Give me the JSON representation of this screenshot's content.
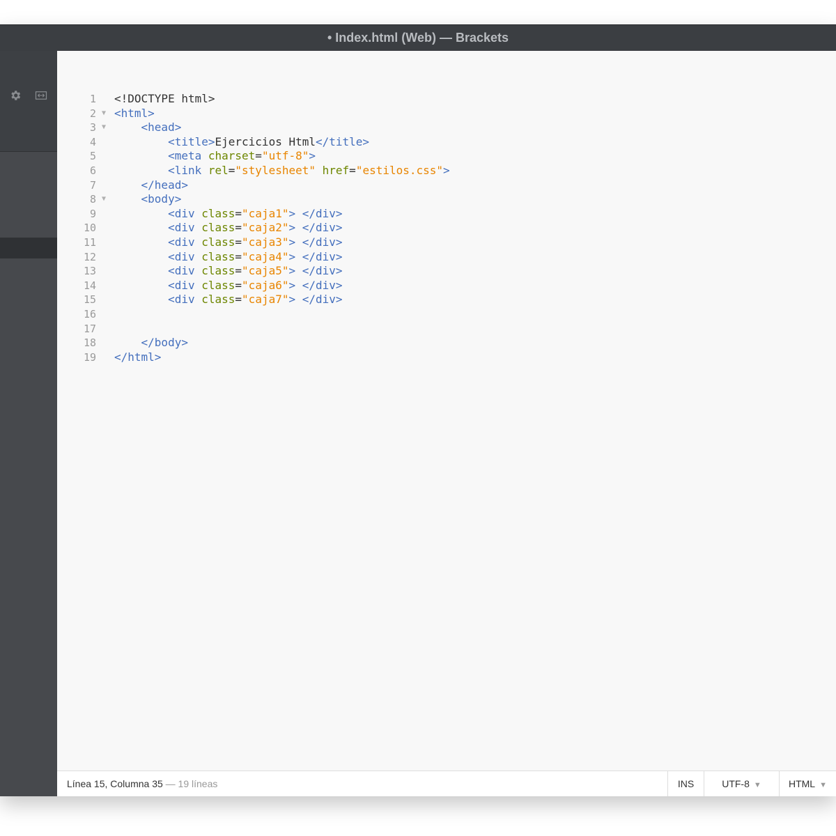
{
  "window": {
    "title": "• Index.html (Web) — Brackets"
  },
  "sidebar": {
    "icons": [
      "gear-icon",
      "split-view-icon"
    ]
  },
  "editor": {
    "lines": [
      {
        "n": "1",
        "fold": false
      },
      {
        "n": "2",
        "fold": true
      },
      {
        "n": "3",
        "fold": true
      },
      {
        "n": "4",
        "fold": false
      },
      {
        "n": "5",
        "fold": false
      },
      {
        "n": "6",
        "fold": false
      },
      {
        "n": "7",
        "fold": false
      },
      {
        "n": "8",
        "fold": true
      },
      {
        "n": "9",
        "fold": false
      },
      {
        "n": "10",
        "fold": false
      },
      {
        "n": "11",
        "fold": false
      },
      {
        "n": "12",
        "fold": false
      },
      {
        "n": "13",
        "fold": false
      },
      {
        "n": "14",
        "fold": false
      },
      {
        "n": "15",
        "fold": false
      },
      {
        "n": "16",
        "fold": false
      },
      {
        "n": "17",
        "fold": false
      },
      {
        "n": "18",
        "fold": false
      },
      {
        "n": "19",
        "fold": false
      }
    ],
    "code": [
      [
        [
          "p",
          "<!DOCTYPE html>"
        ]
      ],
      [
        [
          "t",
          "<html>"
        ]
      ],
      [
        [
          "p",
          "    "
        ],
        [
          "t",
          "<head>"
        ]
      ],
      [
        [
          "p",
          "        "
        ],
        [
          "t",
          "<title>"
        ],
        [
          "p",
          "Ejercicios Html"
        ],
        [
          "t",
          "</title>"
        ]
      ],
      [
        [
          "p",
          "        "
        ],
        [
          "t",
          "<meta "
        ],
        [
          "a",
          "charset"
        ],
        [
          "p",
          "="
        ],
        [
          "v",
          "\"utf-8\""
        ],
        [
          "t",
          ">"
        ]
      ],
      [
        [
          "p",
          "        "
        ],
        [
          "t",
          "<link "
        ],
        [
          "a",
          "rel"
        ],
        [
          "p",
          "="
        ],
        [
          "v",
          "\"stylesheet\""
        ],
        [
          "p",
          " "
        ],
        [
          "a",
          "href"
        ],
        [
          "p",
          "="
        ],
        [
          "v",
          "\"estilos.css\""
        ],
        [
          "t",
          ">"
        ]
      ],
      [
        [
          "p",
          "    "
        ],
        [
          "t",
          "</head>"
        ]
      ],
      [
        [
          "p",
          "    "
        ],
        [
          "t",
          "<body>"
        ]
      ],
      [
        [
          "p",
          "        "
        ],
        [
          "t",
          "<div "
        ],
        [
          "a",
          "class"
        ],
        [
          "p",
          "="
        ],
        [
          "v",
          "\"caja1\""
        ],
        [
          "t",
          ">"
        ],
        [
          "p",
          " "
        ],
        [
          "t",
          "</div>"
        ]
      ],
      [
        [
          "p",
          "        "
        ],
        [
          "t",
          "<div "
        ],
        [
          "a",
          "class"
        ],
        [
          "p",
          "="
        ],
        [
          "v",
          "\"caja2\""
        ],
        [
          "t",
          ">"
        ],
        [
          "p",
          " "
        ],
        [
          "t",
          "</div>"
        ]
      ],
      [
        [
          "p",
          "        "
        ],
        [
          "t",
          "<div "
        ],
        [
          "a",
          "class"
        ],
        [
          "p",
          "="
        ],
        [
          "v",
          "\"caja3\""
        ],
        [
          "t",
          ">"
        ],
        [
          "p",
          " "
        ],
        [
          "t",
          "</div>"
        ]
      ],
      [
        [
          "p",
          "        "
        ],
        [
          "t",
          "<div "
        ],
        [
          "a",
          "class"
        ],
        [
          "p",
          "="
        ],
        [
          "v",
          "\"caja4\""
        ],
        [
          "t",
          ">"
        ],
        [
          "p",
          " "
        ],
        [
          "t",
          "</div>"
        ]
      ],
      [
        [
          "p",
          "        "
        ],
        [
          "t",
          "<div "
        ],
        [
          "a",
          "class"
        ],
        [
          "p",
          "="
        ],
        [
          "v",
          "\"caja5\""
        ],
        [
          "t",
          ">"
        ],
        [
          "p",
          " "
        ],
        [
          "t",
          "</div>"
        ]
      ],
      [
        [
          "p",
          "        "
        ],
        [
          "t",
          "<div "
        ],
        [
          "a",
          "class"
        ],
        [
          "p",
          "="
        ],
        [
          "v",
          "\"caja6\""
        ],
        [
          "t",
          ">"
        ],
        [
          "p",
          " "
        ],
        [
          "t",
          "</div>"
        ]
      ],
      [
        [
          "p",
          "        "
        ],
        [
          "t",
          "<div "
        ],
        [
          "a",
          "class"
        ],
        [
          "p",
          "="
        ],
        [
          "v",
          "\"caja7\""
        ],
        [
          "t",
          ">"
        ],
        [
          "p",
          " "
        ],
        [
          "t",
          "</div>"
        ]
      ],
      [],
      [],
      [
        [
          "p",
          "    "
        ],
        [
          "t",
          "</body>"
        ]
      ],
      [
        [
          "t",
          "</html>"
        ]
      ]
    ],
    "syntax_colors": {
      "tag": "#446fbd",
      "attribute": "#6d8600",
      "value": "#e88501",
      "plain": "#333333"
    }
  },
  "status": {
    "position": "Línea 15, Columna 35",
    "line_count": " — 19 líneas",
    "ins": "INS",
    "encoding": "UTF-8",
    "language": "HTML"
  }
}
